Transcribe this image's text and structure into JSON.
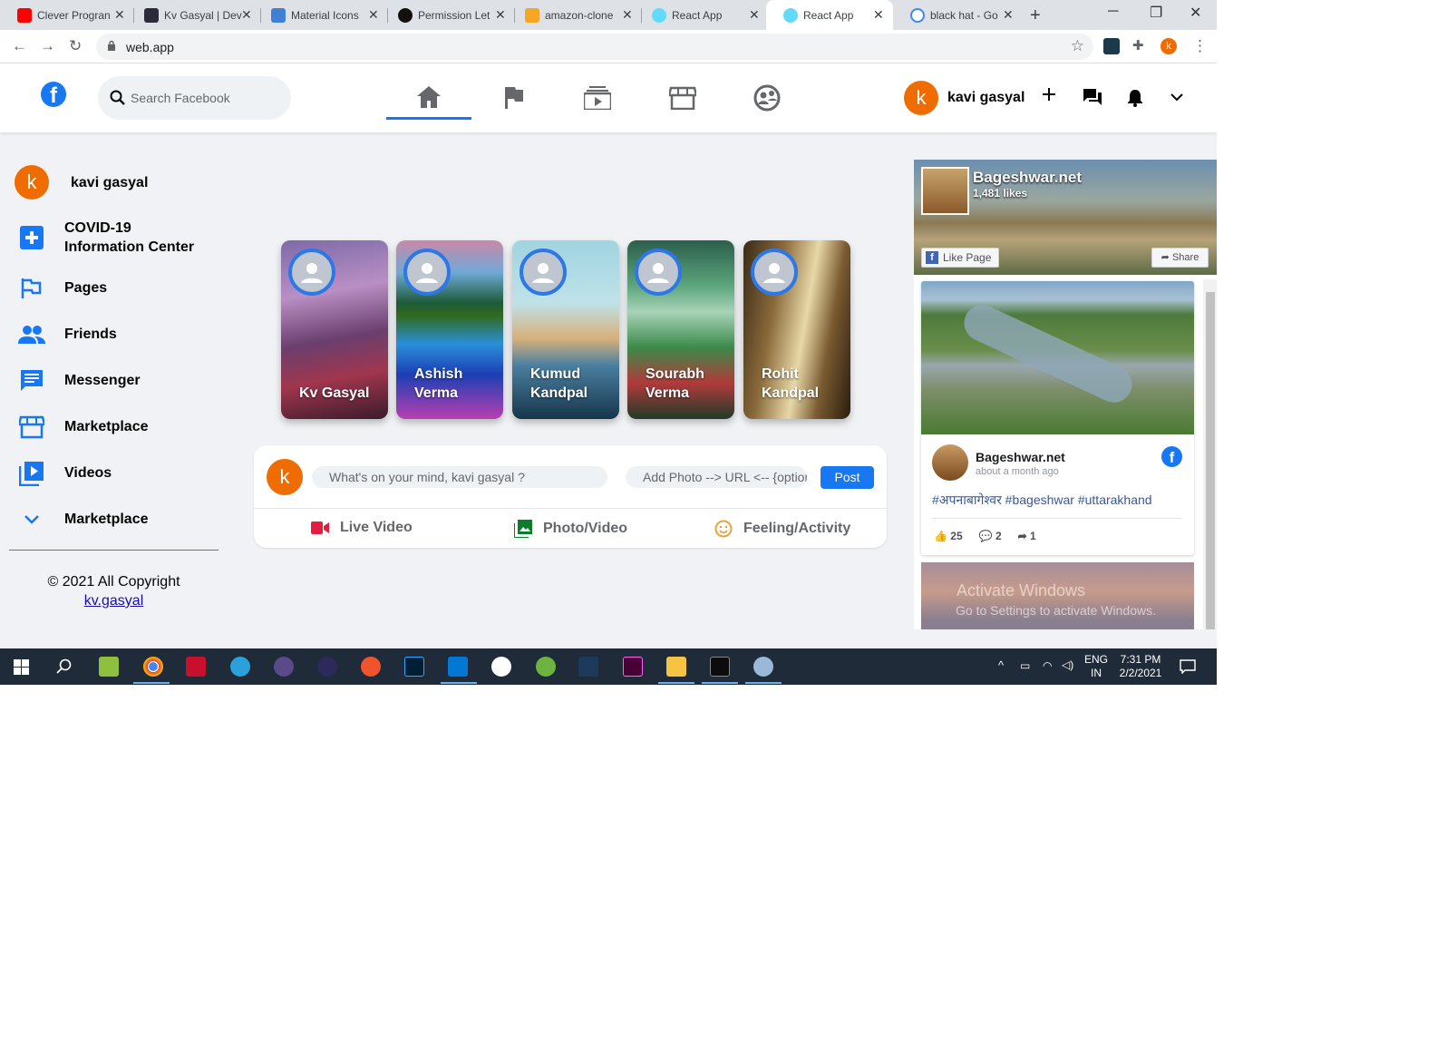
{
  "browser": {
    "tabs": [
      {
        "title": "Clever Progran",
        "color": "#ff0000"
      },
      {
        "title": "Kv Gasyal | Dev",
        "color": "#2b2b3b"
      },
      {
        "title": "Material Icons",
        "color": "#3f7fd6"
      },
      {
        "title": "Permission Let",
        "color": "#111111"
      },
      {
        "title": "amazon-clone",
        "color": "#f5a623"
      },
      {
        "title": "React App",
        "color": "#61dafb"
      },
      {
        "title": "React App",
        "color": "#61dafb"
      },
      {
        "title": "black hat - Go",
        "color": "#4285f4"
      }
    ],
    "url": "web.app",
    "profile_initial": "k"
  },
  "header": {
    "logo": "f",
    "search_placeholder": "Search Facebook",
    "user_name": "kavi gasyal",
    "user_initial": "k"
  },
  "sidebar": {
    "user_name": "kavi gasyal",
    "user_initial": "k",
    "items": [
      {
        "label": "COVID-19 Information Center",
        "icon": "local-hospital-icon"
      },
      {
        "label": "Pages",
        "icon": "flag-icon"
      },
      {
        "label": "Friends",
        "icon": "people-icon"
      },
      {
        "label": "Messenger",
        "icon": "chat-icon"
      },
      {
        "label": "Marketplace",
        "icon": "storefront-icon"
      },
      {
        "label": "Videos",
        "icon": "video-library-icon"
      },
      {
        "label": "Marketplace",
        "icon": "expand-more-icon"
      }
    ],
    "copyright": "© 2021 All Copyright",
    "link": "kv.gasyal"
  },
  "stories": [
    {
      "name": "Kv Gasyal"
    },
    {
      "name": "Ashish Verma"
    },
    {
      "name": "Kumud Kandpal"
    },
    {
      "name": "Sourabh Verma"
    },
    {
      "name": "Rohit Kandpal"
    }
  ],
  "composer": {
    "initial": "k",
    "text_placeholder": "What's on your mind, kavi gasyal ?",
    "url_placeholder": "Add Photo --> URL <--  {optional}",
    "post_label": "Post",
    "actions": [
      {
        "label": "Live Video",
        "color": "#e41e3f"
      },
      {
        "label": "Photo/Video",
        "color": "#0a7d2c"
      },
      {
        "label": "Feeling/Activity",
        "color": "#e7a33e"
      }
    ]
  },
  "page_widget": {
    "page_name": "Bageshwar.net",
    "likes": "1,481 likes",
    "like_label": "Like Page",
    "share_label": "Share",
    "post": {
      "author": "Bageshwar.net",
      "time": "about a month ago",
      "tags": "#अपनाबागेश्वर #bageshwar #uttarakhand",
      "likes": "25",
      "comments": "2",
      "shares": "1"
    }
  },
  "watermark": {
    "line1": "Activate Windows",
    "line2": "Go to Settings to activate Windows."
  },
  "taskbar": {
    "lang": "ENG",
    "region": "IN",
    "time": "7:31 PM",
    "date": "2/2/2021"
  }
}
